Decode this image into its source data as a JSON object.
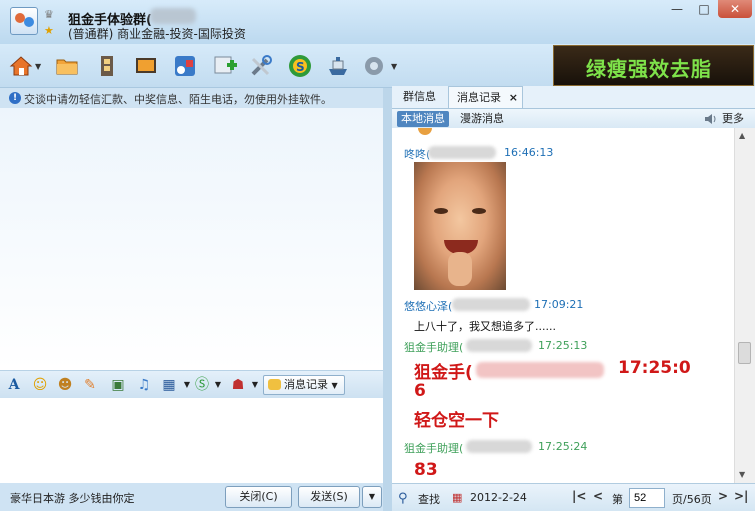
{
  "title": {
    "group_name": "狙金手体验群(",
    "group_desc": "(普通群) 商业金融-投资-国际投资"
  },
  "window_controls": {
    "minimize": "—",
    "maximize": "□",
    "close": "✕"
  },
  "toolbar": {
    "icons": [
      "home-icon",
      "folder-icon",
      "filmstrip-icon",
      "screen-icon",
      "app-icon",
      "add-icon",
      "tools-icon",
      "soso-icon",
      "ship-icon",
      "settings-icon"
    ],
    "ad_text": "绿瘦强效去脂"
  },
  "notice": "交谈中请勿轻信汇款、中奖信息、陌生电话，勿使用外挂软件。",
  "input_toolbar": {
    "message_record_label": "消息记录"
  },
  "bottom_left": {
    "ad_text": "豪华日本游 多少钱由你定",
    "close_label": "关闭(C)",
    "send_label": "发送(S)"
  },
  "right_panel": {
    "tabs": [
      "群信息",
      "消息记录"
    ],
    "tab_close": "×",
    "subtabs": [
      "本地消息",
      "漫游消息"
    ],
    "more_label": "更多"
  },
  "log": {
    "messages": [
      {
        "sender": "咚咚(",
        "time": "16:46:13",
        "text": ""
      },
      {
        "sender": "悠悠心泽(",
        "time": "17:09:21",
        "text": "上八十了，我又想追多了......"
      },
      {
        "sender": "狙金手助理(",
        "time": "17:25:13",
        "text": ""
      },
      {
        "sender": "狙金手助理(",
        "time": "17:25:24",
        "text": ""
      }
    ],
    "big_line1_sender": "狙金手(",
    "big_line1_time": "17:25:0",
    "big_line2": "6",
    "big_line3": "轻仓空一下",
    "big_line4": "83"
  },
  "bottom_right": {
    "search_label": "查找",
    "date": "2012-2-24",
    "page_prefix": "第",
    "page_value": "52",
    "page_suffix": "页/56页"
  },
  "colors": {
    "sender_blue": "#1e6fb5",
    "sender_green": "#3fa05a",
    "highlight_red": "#d01818",
    "ad_green": "#7ee24a"
  }
}
